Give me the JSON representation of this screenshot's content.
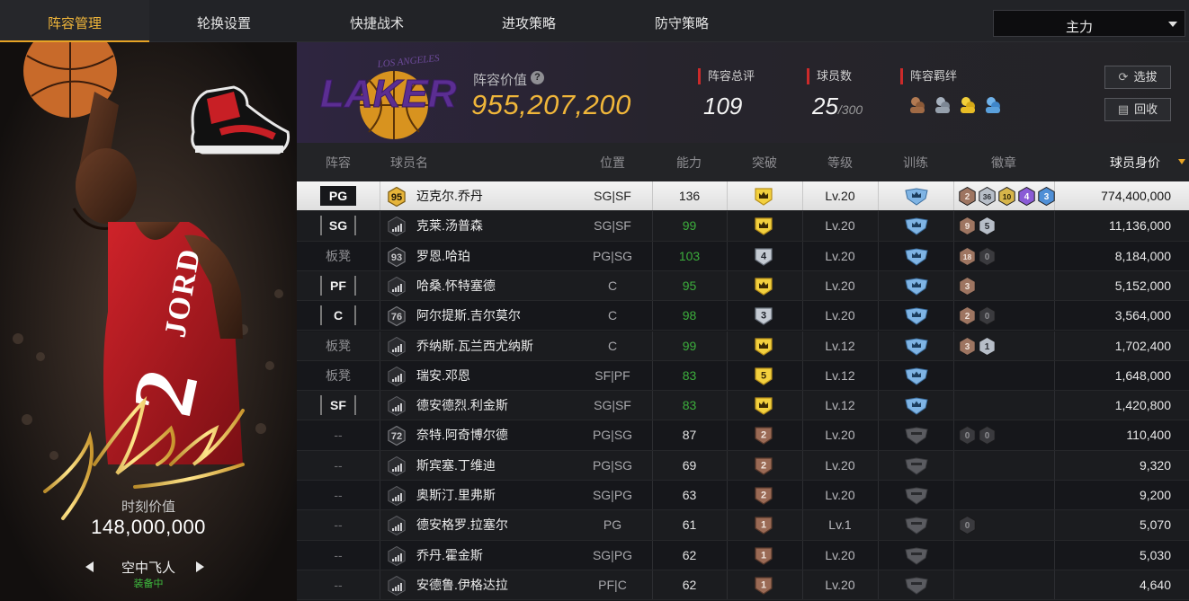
{
  "nav": {
    "tabs": [
      "阵容管理",
      "轮换设置",
      "快捷战术",
      "进攻策略",
      "防守策略"
    ],
    "active": 0,
    "dropdown_value": "主力"
  },
  "card": {
    "value_label": "时刻价值",
    "value": "148,000,000",
    "skin_name": "空中飞人",
    "status": "装备中",
    "signature": "I'm Back",
    "jersey_text": "JORDAN 23"
  },
  "summary": {
    "lineup_value_label": "阵容价值",
    "lineup_value": "955,207,200",
    "overall_label": "阵容总评",
    "overall": "109",
    "players_label": "球员数",
    "players": "25",
    "players_max": "/300",
    "bonds_label": "阵容羁绊",
    "bond_icons": [
      "bond-bronze-icon",
      "bond-silver-icon",
      "bond-gold-icon",
      "bond-blue-icon"
    ],
    "logo_text": "LOS ANGELES LAKERS",
    "scout_label": "选拔",
    "recycle_label": "回收"
  },
  "table": {
    "headers": [
      "阵容",
      "球员名",
      "位置",
      "能力",
      "突破",
      "等级",
      "训练",
      "徽章",
      "球员身价"
    ],
    "rows": [
      {
        "role": "PG",
        "role_style": "tag",
        "rating": "95",
        "name": "迈克尔.乔丹",
        "pos": "SG|SF",
        "ability": "136",
        "ability_color": "white",
        "breakthrough": "crown",
        "bt_color": "gold",
        "level": "Lv.20",
        "train": "blue",
        "badges": [
          {
            "n": "2",
            "c": "bronze"
          },
          {
            "n": "36",
            "c": "silver"
          },
          {
            "n": "10",
            "c": "gold"
          },
          {
            "n": "4",
            "c": "purple"
          },
          {
            "n": "3",
            "c": "blue"
          }
        ],
        "price": "774,400,000",
        "selected": true
      },
      {
        "role": "SG",
        "role_style": "tag",
        "rating": "",
        "name": "克莱.汤普森",
        "pos": "SG|SF",
        "ability": "99",
        "ability_color": "green",
        "breakthrough": "crown",
        "bt_color": "gold",
        "level": "Lv.20",
        "train": "blue",
        "badges": [
          {
            "n": "9",
            "c": "bronze"
          },
          {
            "n": "5",
            "c": "silver"
          }
        ],
        "price": "11,136,000"
      },
      {
        "role": "板凳",
        "role_style": "text",
        "rating": "93",
        "name": "罗恩.哈珀",
        "pos": "PG|SG",
        "ability": "103",
        "ability_color": "green",
        "breakthrough": "4",
        "bt_color": "silver",
        "level": "Lv.20",
        "train": "blue",
        "badges": [
          {
            "n": "18",
            "c": "bronze"
          },
          {
            "n": "0",
            "c": "dark"
          }
        ],
        "price": "8,184,000"
      },
      {
        "role": "PF",
        "role_style": "tag",
        "rating": "",
        "name": "哈桑.怀特塞德",
        "pos": "C",
        "ability": "95",
        "ability_color": "green",
        "breakthrough": "crown",
        "bt_color": "gold",
        "level": "Lv.20",
        "train": "blue",
        "badges": [
          {
            "n": "3",
            "c": "bronze"
          }
        ],
        "price": "5,152,000"
      },
      {
        "role": "C",
        "role_style": "tag",
        "rating": "76",
        "name": "阿尔提斯.吉尔莫尔",
        "pos": "C",
        "ability": "98",
        "ability_color": "green",
        "breakthrough": "3",
        "bt_color": "silver",
        "level": "Lv.20",
        "train": "blue",
        "badges": [
          {
            "n": "2",
            "c": "bronze"
          },
          {
            "n": "0",
            "c": "dark"
          }
        ],
        "price": "3,564,000"
      },
      {
        "role": "板凳",
        "role_style": "text",
        "rating": "",
        "name": "乔纳斯.瓦兰西尤纳斯",
        "pos": "C",
        "ability": "99",
        "ability_color": "green",
        "breakthrough": "crown",
        "bt_color": "gold",
        "level": "Lv.12",
        "train": "blue",
        "badges": [
          {
            "n": "3",
            "c": "bronze"
          },
          {
            "n": "1",
            "c": "silver"
          }
        ],
        "price": "1,702,400"
      },
      {
        "role": "板凳",
        "role_style": "text",
        "rating": "",
        "name": "瑞安.邓恩",
        "pos": "SF|PF",
        "ability": "83",
        "ability_color": "green",
        "breakthrough": "5",
        "bt_color": "gold",
        "level": "Lv.12",
        "train": "blue",
        "badges": [],
        "price": "1,648,000"
      },
      {
        "role": "SF",
        "role_style": "tag",
        "rating": "",
        "name": "德安德烈.利金斯",
        "pos": "SG|SF",
        "ability": "83",
        "ability_color": "green",
        "breakthrough": "crown",
        "bt_color": "gold",
        "level": "Lv.12",
        "train": "blue",
        "badges": [],
        "price": "1,420,800"
      },
      {
        "role": "--",
        "role_style": "none",
        "rating": "72",
        "name": "奈特.阿奇博尔德",
        "pos": "PG|SG",
        "ability": "87",
        "ability_color": "white",
        "breakthrough": "2",
        "bt_color": "bronze",
        "level": "Lv.20",
        "train": "dark",
        "badges": [
          {
            "n": "0",
            "c": "dark"
          },
          {
            "n": "0",
            "c": "dark"
          }
        ],
        "price": "110,400"
      },
      {
        "role": "--",
        "role_style": "none",
        "rating": "",
        "name": "斯宾塞.丁维迪",
        "pos": "PG|SG",
        "ability": "69",
        "ability_color": "white",
        "breakthrough": "2",
        "bt_color": "bronze",
        "level": "Lv.20",
        "train": "dark",
        "badges": [],
        "price": "9,320"
      },
      {
        "role": "--",
        "role_style": "none",
        "rating": "",
        "name": "奥斯汀.里弗斯",
        "pos": "SG|PG",
        "ability": "63",
        "ability_color": "white",
        "breakthrough": "2",
        "bt_color": "bronze",
        "level": "Lv.20",
        "train": "dark",
        "badges": [],
        "price": "9,200"
      },
      {
        "role": "--",
        "role_style": "none",
        "rating": "",
        "name": "德安格罗.拉塞尔",
        "pos": "PG",
        "ability": "61",
        "ability_color": "white",
        "breakthrough": "1",
        "bt_color": "bronze",
        "level": "Lv.1",
        "train": "dark",
        "badges": [
          {
            "n": "0",
            "c": "dark"
          }
        ],
        "price": "5,070"
      },
      {
        "role": "--",
        "role_style": "none",
        "rating": "",
        "name": "乔丹.霍金斯",
        "pos": "SG|PG",
        "ability": "62",
        "ability_color": "white",
        "breakthrough": "1",
        "bt_color": "bronze",
        "level": "Lv.20",
        "train": "dark",
        "badges": [],
        "price": "5,030"
      },
      {
        "role": "--",
        "role_style": "none",
        "rating": "",
        "name": "安德鲁.伊格达拉",
        "pos": "PF|C",
        "ability": "62",
        "ability_color": "white",
        "breakthrough": "1",
        "bt_color": "bronze",
        "level": "Lv.20",
        "train": "dark",
        "badges": [],
        "price": "4,640"
      }
    ]
  },
  "colors": {
    "accent": "#f0b63a",
    "green": "#3cae3c",
    "red_marker": "#cc2a2a"
  }
}
